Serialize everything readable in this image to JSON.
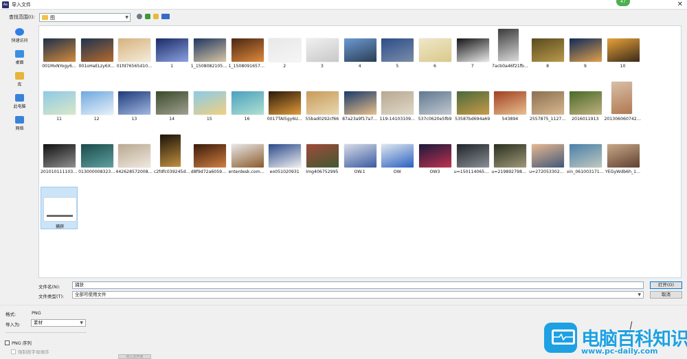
{
  "window": {
    "title": "导入文件",
    "app_icon": "adobe-app-icon",
    "badge": "47"
  },
  "toolbar": {
    "lookin_label": "查找范围(I):",
    "lookin_value": "图"
  },
  "places": [
    {
      "label": "快速访问",
      "icon": "star-icon",
      "color": "#2f7ee8"
    },
    {
      "label": "桌面",
      "icon": "desktop-icon",
      "color": "#3c8ee0"
    },
    {
      "label": "库",
      "icon": "library-icon",
      "color": "#e6b43c"
    },
    {
      "label": "此电脑",
      "icon": "computer-icon",
      "color": "#3a82d8"
    },
    {
      "label": "网络",
      "icon": "network-icon",
      "color": "#3a82d8"
    }
  ],
  "files": [
    {
      "name": "001MxNYogy6...",
      "c1": "#1d2f4a",
      "c2": "#d38b3c"
    },
    {
      "name": "001oHaELzy6X...",
      "c1": "#1e3351",
      "c2": "#b56a2e"
    },
    {
      "name": "01fd76565d10...",
      "c1": "#d7b27f",
      "c2": "#f4ecd9"
    },
    {
      "name": "1",
      "c1": "#1b2a66",
      "c2": "#8aa2e0"
    },
    {
      "name": "1_15080821053...",
      "c1": "#203660",
      "c2": "#d7c6a4"
    },
    {
      "name": "1_15080916573...",
      "c1": "#4a2612",
      "c2": "#e08a3d"
    },
    {
      "name": "2",
      "c1": "#e8e8e8",
      "c2": "#f5f5f5"
    },
    {
      "name": "3",
      "c1": "#f0f0f0",
      "c2": "#c8c8c8"
    },
    {
      "name": "4",
      "c1": "#6b9ad2",
      "c2": "#2b3d54"
    },
    {
      "name": "5",
      "c1": "#2c4d8a",
      "c2": "#7a8da8"
    },
    {
      "name": "6",
      "c1": "#efe7c8",
      "c2": "#d9c98a"
    },
    {
      "name": "7",
      "c1": "#151515",
      "c2": "#e9e9e9"
    },
    {
      "name": "7acb0a46f21fb...",
      "c1": "#3a3a3a",
      "c2": "#dadada",
      "portrait": true
    },
    {
      "name": "8",
      "c1": "#5a4a1e",
      "c2": "#b89a4a"
    },
    {
      "name": "9",
      "c1": "#0f2a5a",
      "c2": "#e0a04a"
    },
    {
      "name": "10",
      "c1": "#e8a23a",
      "c2": "#3a2a1a"
    },
    {
      "name": "11",
      "c1": "#8fc9e6",
      "c2": "#d8e8c8"
    },
    {
      "name": "12",
      "c1": "#6fa8e0",
      "c2": "#e8f0f8"
    },
    {
      "name": "13",
      "c1": "#1e3a7a",
      "c2": "#a0b8e0"
    },
    {
      "name": "14",
      "c1": "#3a4a2a",
      "c2": "#a0a090"
    },
    {
      "name": "15",
      "c1": "#8acbe8",
      "c2": "#f0d080"
    },
    {
      "name": "16",
      "c1": "#4aa0c0",
      "c2": "#b0e0d0"
    },
    {
      "name": "0017TAI5gy6U...",
      "c1": "#2a1a0a",
      "c2": "#e09a3a"
    },
    {
      "name": "55bad0292cf66",
      "c1": "#c89a5a",
      "c2": "#e8d8b0"
    },
    {
      "name": "87a23a9f17a7...",
      "c1": "#1a3a6a",
      "c2": "#e8c08a"
    },
    {
      "name": "119-14103109...",
      "c1": "#b8a890",
      "c2": "#e0d8c8"
    },
    {
      "name": "537c0620e5fb9",
      "c1": "#607890",
      "c2": "#c0c8d0"
    },
    {
      "name": "53587bd694a69",
      "c1": "#4a6a3a",
      "c2": "#c89a4a"
    },
    {
      "name": "543894",
      "c1": "#a04020",
      "c2": "#e8c090"
    },
    {
      "name": "2557875_1127...",
      "c1": "#8a7050",
      "c2": "#d8b890"
    },
    {
      "name": "2016011913",
      "c1": "#4a6a2a",
      "c2": "#c0b080"
    },
    {
      "name": "2013060607421...",
      "c1": "#d8c0a8",
      "c2": "#b07850",
      "portrait": true
    },
    {
      "name": "2010101111030...",
      "c1": "#101010",
      "c2": "#909090"
    },
    {
      "name": "013000008323...",
      "c1": "#1a4a4a",
      "c2": "#60a0a0"
    },
    {
      "name": "4426285720080...",
      "c1": "#b8a890",
      "c2": "#f0e8e0"
    },
    {
      "name": "c2fdfc039245d...",
      "c1": "#1a1208",
      "c2": "#c09040",
      "portrait": true
    },
    {
      "name": "d8f9d72a60592...",
      "c1": "#3a1a0a",
      "c2": "#d08040"
    },
    {
      "name": "enterdesk.com-...",
      "c1": "#e8e8e8",
      "c2": "#8a5a2a"
    },
    {
      "name": "eo051020931",
      "c1": "#2a4a8a",
      "c2": "#f0f0f0"
    },
    {
      "name": "Img406752995",
      "c1": "#a04a3a",
      "c2": "#405a30"
    },
    {
      "name": "OW.1",
      "c1": "#d8dce8",
      "c2": "#3a5aa0"
    },
    {
      "name": "OW",
      "c1": "#e0e8f0",
      "c2": "#2a60c0"
    },
    {
      "name": "OW3",
      "c1": "#1a1a3a",
      "c2": "#c03050"
    },
    {
      "name": "u=1501140656...",
      "c1": "#202428",
      "c2": "#8a9098"
    },
    {
      "name": "u=2198927985...",
      "c1": "#2a3020",
      "c2": "#a09878"
    },
    {
      "name": "u=2720533028...",
      "c1": "#e8b890",
      "c2": "#405878"
    },
    {
      "name": "xin_061003171...",
      "c1": "#4a80a8",
      "c2": "#c0c8c0"
    },
    {
      "name": "YEGyWdb6h_1...",
      "c1": "#c8a888",
      "c2": "#604030"
    },
    {
      "name": "捕获",
      "c1": "#ffffff",
      "c2": "#ffffff",
      "selected": true
    }
  ],
  "bottom": {
    "name_label": "文件名(N):",
    "name_value": "捕获",
    "type_label": "文件类型(T):",
    "type_value": "全部可使用文件",
    "open_label": "打开(O)",
    "cancel_label": "取消"
  },
  "panel": {
    "format_label": "格式:",
    "format_value": "PNG",
    "importas_label": "导入为:",
    "importas_value": "素材",
    "png_sequence_label": "PNG 序列",
    "force_order_label": "强制按字母顺序",
    "bottom_button_label": "导入文件夹"
  },
  "watermark": {
    "title": "电脑百科知识",
    "url": "www.pc-daily.com",
    "color": "#1da1e2"
  }
}
